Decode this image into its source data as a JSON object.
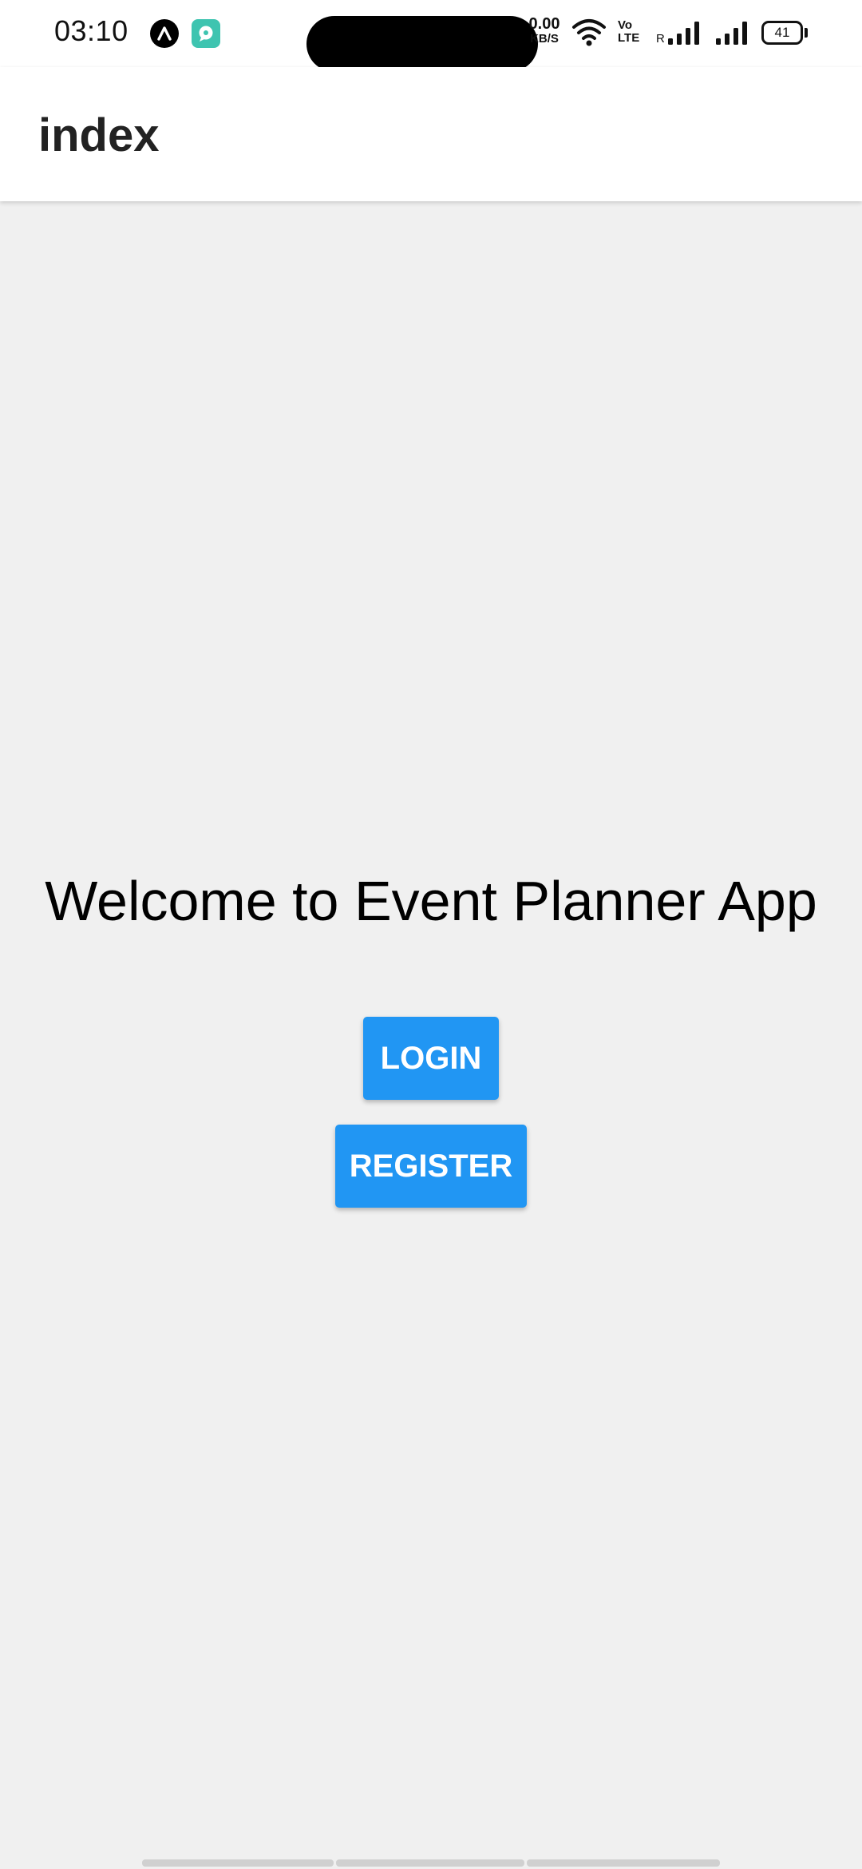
{
  "status_bar": {
    "time": "03:10",
    "net_speed_value": "0.00",
    "net_speed_unit": "KB/S",
    "volte_line1": "Vo",
    "volte_line2": "LTE",
    "roaming": "R",
    "battery_level": "41",
    "notification_icons": [
      "app-a-icon",
      "chat-bubble-icon"
    ]
  },
  "app_bar": {
    "title": "index"
  },
  "main": {
    "welcome_text": "Welcome to Event Planner App",
    "login_label": "LOGIN",
    "register_label": "REGISTER"
  },
  "colors": {
    "primary": "#2196f3",
    "background": "#f0f0f0",
    "app_bar": "#ffffff"
  }
}
